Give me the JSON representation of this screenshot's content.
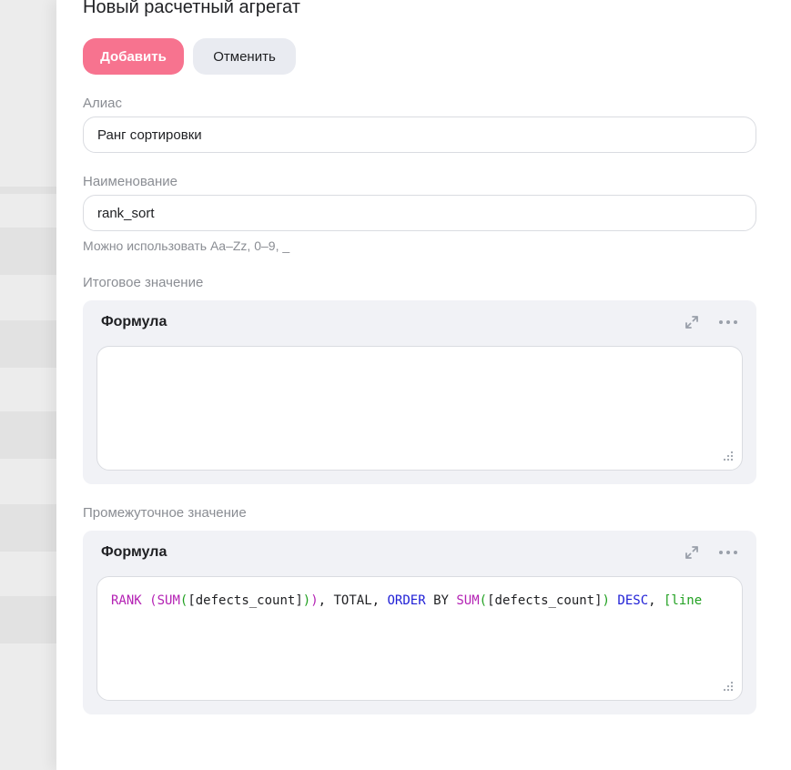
{
  "drawer": {
    "title": "Новый расчетный агрегат",
    "add_button": "Добавить",
    "cancel_button": "Отменить"
  },
  "alias": {
    "label": "Алиас",
    "value": "Ранг сортировки"
  },
  "name": {
    "label": "Наименование",
    "value": "rank_sort",
    "hint": "Можно использовать Aa–Zz, 0–9, _"
  },
  "final_value": {
    "section_label": "Итоговое значение",
    "card_title": "Формула",
    "formula": ""
  },
  "intermediate_value": {
    "section_label": "Промежуточное значение",
    "card_title": "Формула",
    "formula_tokens": [
      {
        "text": "RANK ",
        "kind": "fn"
      },
      {
        "text": "(",
        "kind": "fn"
      },
      {
        "text": "SUM",
        "kind": "fn"
      },
      {
        "text": "(",
        "kind": "field"
      },
      {
        "text": "[defects_count]",
        "kind": "plain"
      },
      {
        "text": ")",
        "kind": "field"
      },
      {
        "text": ")",
        "kind": "fn"
      },
      {
        "text": ", TOTAL, ",
        "kind": "plain"
      },
      {
        "text": "ORDER",
        "kind": "kw"
      },
      {
        "text": " BY ",
        "kind": "plain"
      },
      {
        "text": "SUM",
        "kind": "fn"
      },
      {
        "text": "(",
        "kind": "field"
      },
      {
        "text": "[defects_count]",
        "kind": "plain"
      },
      {
        "text": ")",
        "kind": "field"
      },
      {
        "text": " ",
        "kind": "plain"
      },
      {
        "text": "DESC",
        "kind": "kw"
      },
      {
        "text": ", ",
        "kind": "plain"
      },
      {
        "text": "[line",
        "kind": "field"
      }
    ]
  },
  "icons": {
    "expand": "expand-icon",
    "more": "more-icon",
    "resize": "resize-handle-icon"
  },
  "colors": {
    "accent": "#f7738f",
    "secondary_button": "#e9ebf1",
    "card_bg": "#f1f2f6",
    "muted_text": "#8a8d93",
    "code_function": "#b422b4",
    "code_keyword": "#1f1fd6",
    "code_bracket": "#20a020"
  }
}
